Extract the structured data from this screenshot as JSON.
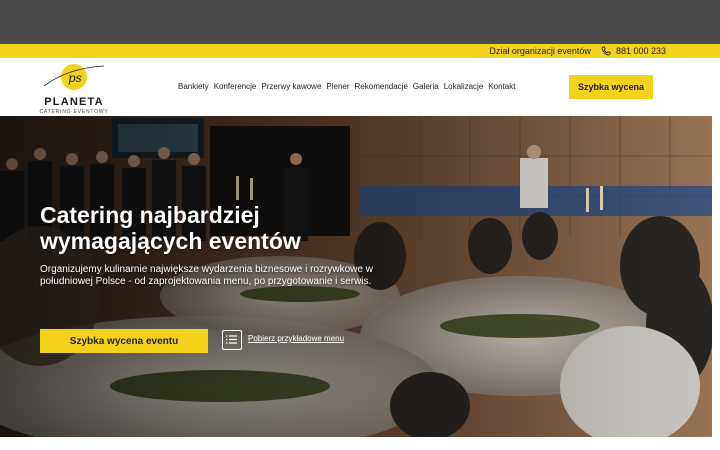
{
  "topbar": {
    "department": "Dział organizacji eventów",
    "phone": "881 000 233",
    "phone_icon": "phone-icon"
  },
  "logo": {
    "name": "PLANETA",
    "subtitle": "CATERING EVENTOWY",
    "monogram": "ps"
  },
  "menu": {
    "items": [
      "Bankiety",
      "Konferencje",
      "Przerwy kawowe",
      "Plener",
      "Rekomendacje",
      "Galeria",
      "Lokalizacje",
      "Kontakt"
    ]
  },
  "header_cta": "Szybka wycena",
  "hero": {
    "title": "Catering najbardziej wymagających eventów",
    "description": "Organizujemy kulinarnie największe wydarzenia biznesowe i rozrywkowe w południowej Polsce - od zaprojektowania menu, po przygotowanie i serwis.",
    "cta": "Szybka wycena eventu",
    "menu_link": "Pobierz przykładowe menu",
    "menu_icon": "menu-list-icon"
  },
  "colors": {
    "accent": "#f2d21b",
    "browser_bar": "#4a4a4a"
  }
}
